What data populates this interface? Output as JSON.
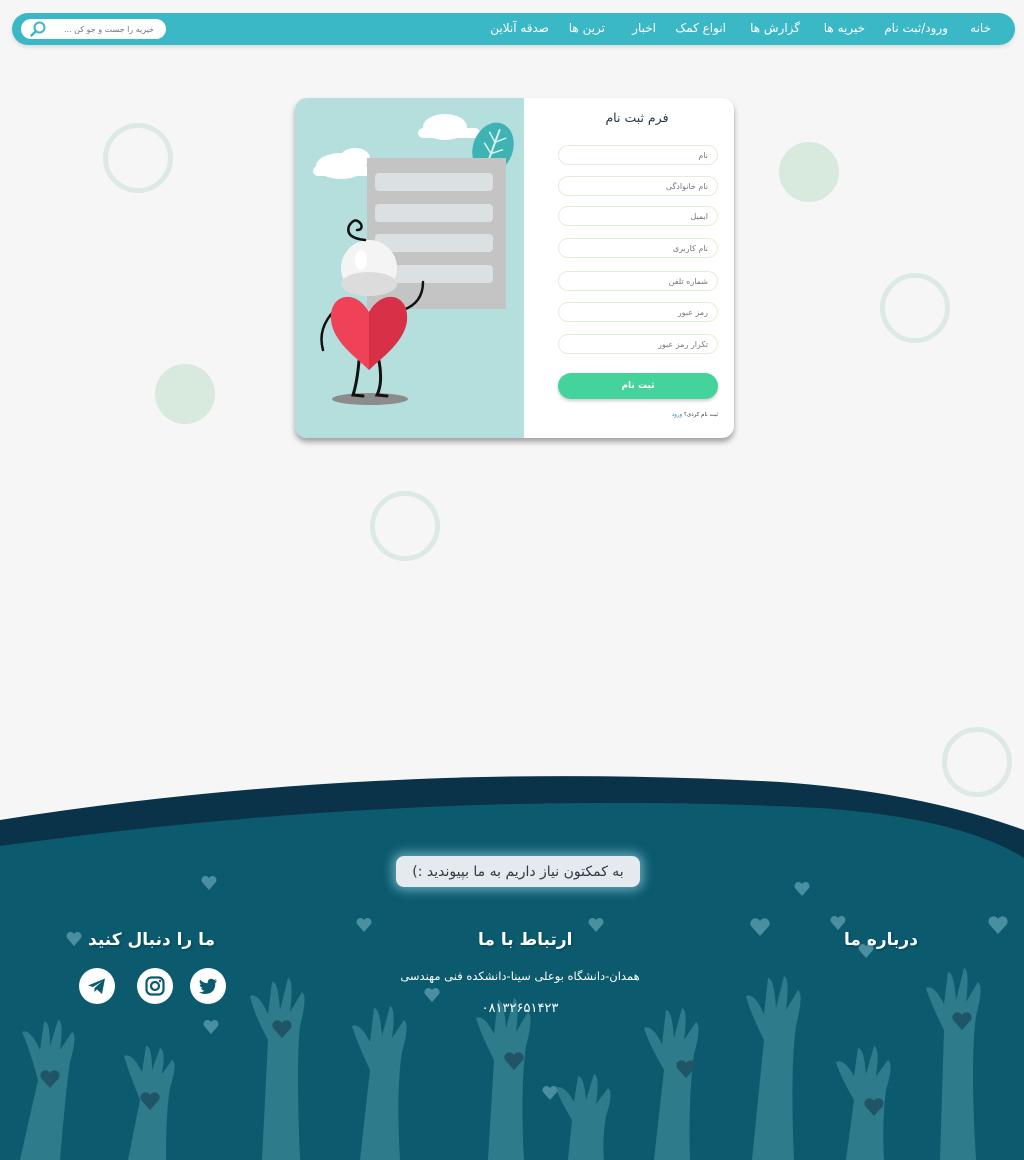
{
  "nav": {
    "items": [
      {
        "label": "خانه"
      },
      {
        "label": "ورود/ثبت نام"
      },
      {
        "label": "خیریه ها"
      },
      {
        "label": "گزارش ها"
      },
      {
        "label": "انواع کمک"
      },
      {
        "label": "اخبار"
      },
      {
        "label": "ترین ها"
      },
      {
        "label": "صدقه آنلاین"
      }
    ],
    "search_placeholder": "خیریه را جست و جو کن ..."
  },
  "form": {
    "title": "فرم ثبت نام",
    "fields": [
      {
        "placeholder": "نام"
      },
      {
        "placeholder": "نام خانوادگی"
      },
      {
        "placeholder": "ایمیل"
      },
      {
        "placeholder": "نام کاربری"
      },
      {
        "placeholder": "شماره تلفن"
      },
      {
        "placeholder": "رمز عبور"
      },
      {
        "placeholder": "تکرار رمز عبور"
      }
    ],
    "submit_label": "ثبت نام",
    "already_registered": "ثبت نام کردی؟",
    "login_link": "ورود"
  },
  "footer": {
    "cta_label": "به کمکتون نیاز داریم به ما بپیوندید :)",
    "about_heading": "درباره ما",
    "contact_heading": "ارتباط با ما",
    "address": "همدان-دانشگاه بوعلی سینا-دانشکده فنی مهندسی",
    "phone": "۰۸۱۳۲۶۵۱۴۲۳",
    "follow_heading": "ما را دنبال کنید",
    "social": [
      "twitter-icon",
      "instagram-icon",
      "telegram-icon"
    ]
  },
  "colors": {
    "navbar": "#3bb8c6",
    "submit": "#45d39c",
    "footer": "#0b5a6e",
    "footer_dark": "#0a3248"
  }
}
